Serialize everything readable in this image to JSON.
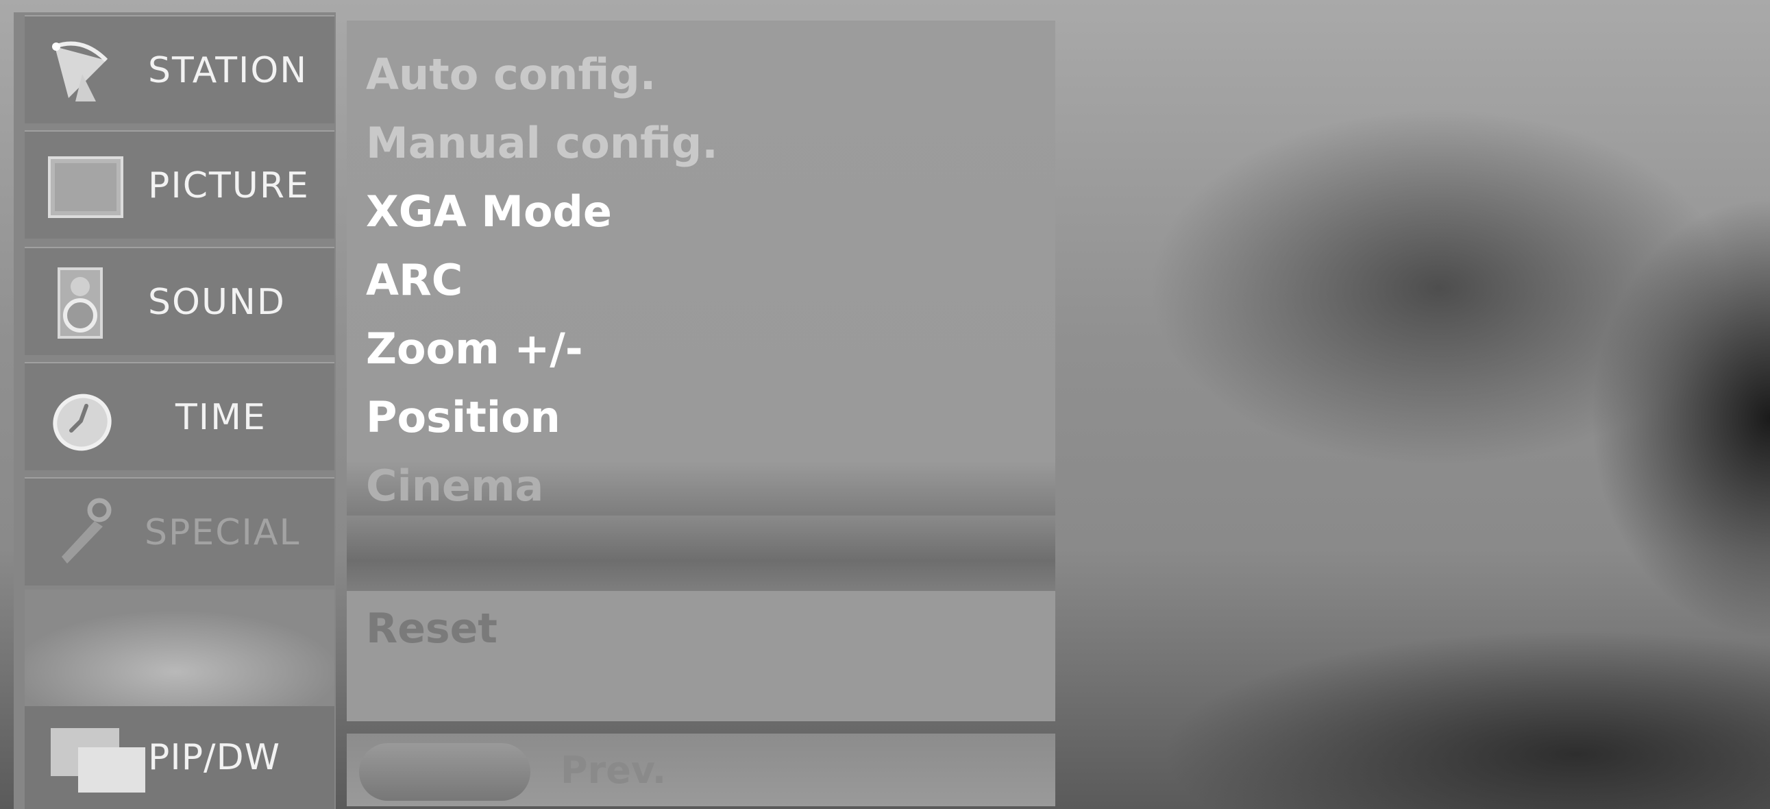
{
  "categories": [
    {
      "label": "STATION",
      "icon": "satellite-dish-icon",
      "state": "normal"
    },
    {
      "label": "PICTURE",
      "icon": "picture-square-icon",
      "state": "normal"
    },
    {
      "label": "SOUND",
      "icon": "speaker-icon",
      "state": "normal"
    },
    {
      "label": "TIME",
      "icon": "clock-icon",
      "state": "normal"
    },
    {
      "label": "SPECIAL",
      "icon": "key-tag-icon",
      "state": "disabled"
    }
  ],
  "pip": {
    "label": "PIP/DW",
    "icon": "pip-windows-icon"
  },
  "menu_items": [
    {
      "label": "Auto config.",
      "state": "disabled"
    },
    {
      "label": "Manual config.",
      "state": "disabled"
    },
    {
      "label": "XGA Mode",
      "state": "normal"
    },
    {
      "label": "ARC",
      "state": "normal"
    },
    {
      "label": "Zoom +/-",
      "state": "normal"
    },
    {
      "label": "Position",
      "state": "normal"
    },
    {
      "label": "Cinema",
      "state": "disabled"
    }
  ],
  "reset": {
    "label": "Reset"
  },
  "prev": {
    "label": "Prev."
  }
}
